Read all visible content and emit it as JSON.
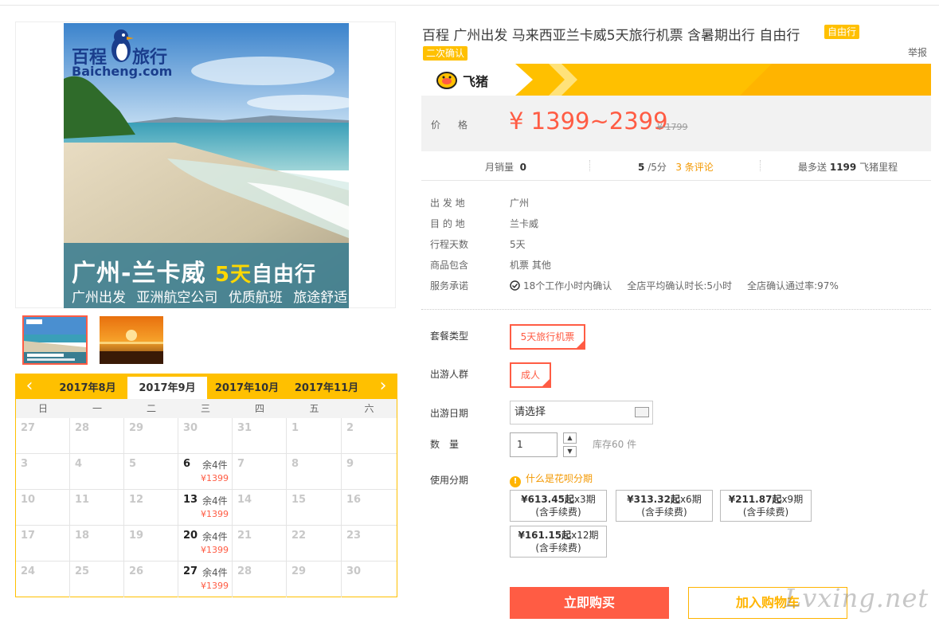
{
  "product": {
    "title": "百程 广州出发 马来西亚兰卡威5天旅行机票 含暑期出行 自由行",
    "tag_freetravel": "自由行",
    "tag_reconfirm": "二次确认",
    "report": "举报"
  },
  "hero": {
    "logo_cn": "百程",
    "logo_cn2": "旅行",
    "logo_en": "Baicheng.com",
    "headline": "广州-兰卡威",
    "headline_days": "5天",
    "headline_type": "自由行",
    "tagline": [
      "广州出发",
      "亚洲航空公司",
      "优质航班",
      "旅途舒适"
    ]
  },
  "brand": {
    "name": "飞猪"
  },
  "price": {
    "label": "价格",
    "range": "¥ 1399~2399",
    "original": "¥ 1799"
  },
  "stats": {
    "monthly_sales_label": "月销量",
    "monthly_sales": "0",
    "rating": "5",
    "rating_suffix": "/5分",
    "reviews": "3 条评论",
    "points_prefix": "最多送",
    "points": "1199",
    "points_suffix": "飞猪里程"
  },
  "attributes": [
    {
      "key": "出 发 地",
      "value": "广州"
    },
    {
      "key": "目 的 地",
      "value": "兰卡威"
    },
    {
      "key": "行程天数",
      "value": "5天"
    },
    {
      "key": "商品包含",
      "value": "机票  其他"
    },
    {
      "key": "服务承诺",
      "value": ""
    }
  ],
  "service": {
    "item1": "18个工作小时内确认",
    "item2": "全店平均确认时长:5小时",
    "item3": "全店确认通过率:97%"
  },
  "options": {
    "package_label": "套餐类型",
    "package_value": "5天旅行机票",
    "crowd_label": "出游人群",
    "crowd_value": "成人",
    "date_label": "出游日期",
    "date_placeholder": "请选择",
    "qty_label": "数　量",
    "qty_value": "1",
    "stock": "库存60 件",
    "installment_label": "使用分期",
    "installment_help": "什么是花呗分期"
  },
  "installments": [
    {
      "amount": "¥613.45起",
      "periods": "x3期",
      "note": "(含手续费)"
    },
    {
      "amount": "¥313.32起",
      "periods": "x6期",
      "note": "(含手续费)"
    },
    {
      "amount": "¥211.87起",
      "periods": "x9期",
      "note": "(含手续费)"
    },
    {
      "amount": "¥161.15起",
      "periods": "x12期",
      "note": "(含手续费)"
    }
  ],
  "actions": {
    "buy": "立即购买",
    "cart": "加入购物车"
  },
  "watermark": "Lvxing.net",
  "calendar": {
    "months": [
      "2017年8月",
      "2017年9月",
      "2017年10月",
      "2017年11月"
    ],
    "active_month": 1,
    "weekdays": [
      "日",
      "一",
      "二",
      "三",
      "四",
      "五",
      "六"
    ],
    "weeks": [
      [
        {
          "d": "27"
        },
        {
          "d": "28"
        },
        {
          "d": "29"
        },
        {
          "d": "30"
        },
        {
          "d": "31"
        },
        {
          "d": "1"
        },
        {
          "d": "2"
        }
      ],
      [
        {
          "d": "3"
        },
        {
          "d": "4"
        },
        {
          "d": "5"
        },
        {
          "d": "6",
          "stock": "余4件",
          "price": "¥1399"
        },
        {
          "d": "7"
        },
        {
          "d": "8"
        },
        {
          "d": "9"
        }
      ],
      [
        {
          "d": "10"
        },
        {
          "d": "11"
        },
        {
          "d": "12"
        },
        {
          "d": "13",
          "stock": "余4件",
          "price": "¥1399"
        },
        {
          "d": "14"
        },
        {
          "d": "15"
        },
        {
          "d": "16"
        }
      ],
      [
        {
          "d": "17"
        },
        {
          "d": "18"
        },
        {
          "d": "19"
        },
        {
          "d": "20",
          "stock": "余4件",
          "price": "¥1399"
        },
        {
          "d": "21"
        },
        {
          "d": "22"
        },
        {
          "d": "23"
        }
      ],
      [
        {
          "d": "24"
        },
        {
          "d": "25"
        },
        {
          "d": "26"
        },
        {
          "d": "27",
          "stock": "余4件",
          "price": "¥1399"
        },
        {
          "d": "28"
        },
        {
          "d": "29"
        },
        {
          "d": "30"
        }
      ]
    ]
  },
  "colors": {
    "accent": "#ffc000",
    "price": "#ff5c44",
    "link": "#f39800"
  }
}
